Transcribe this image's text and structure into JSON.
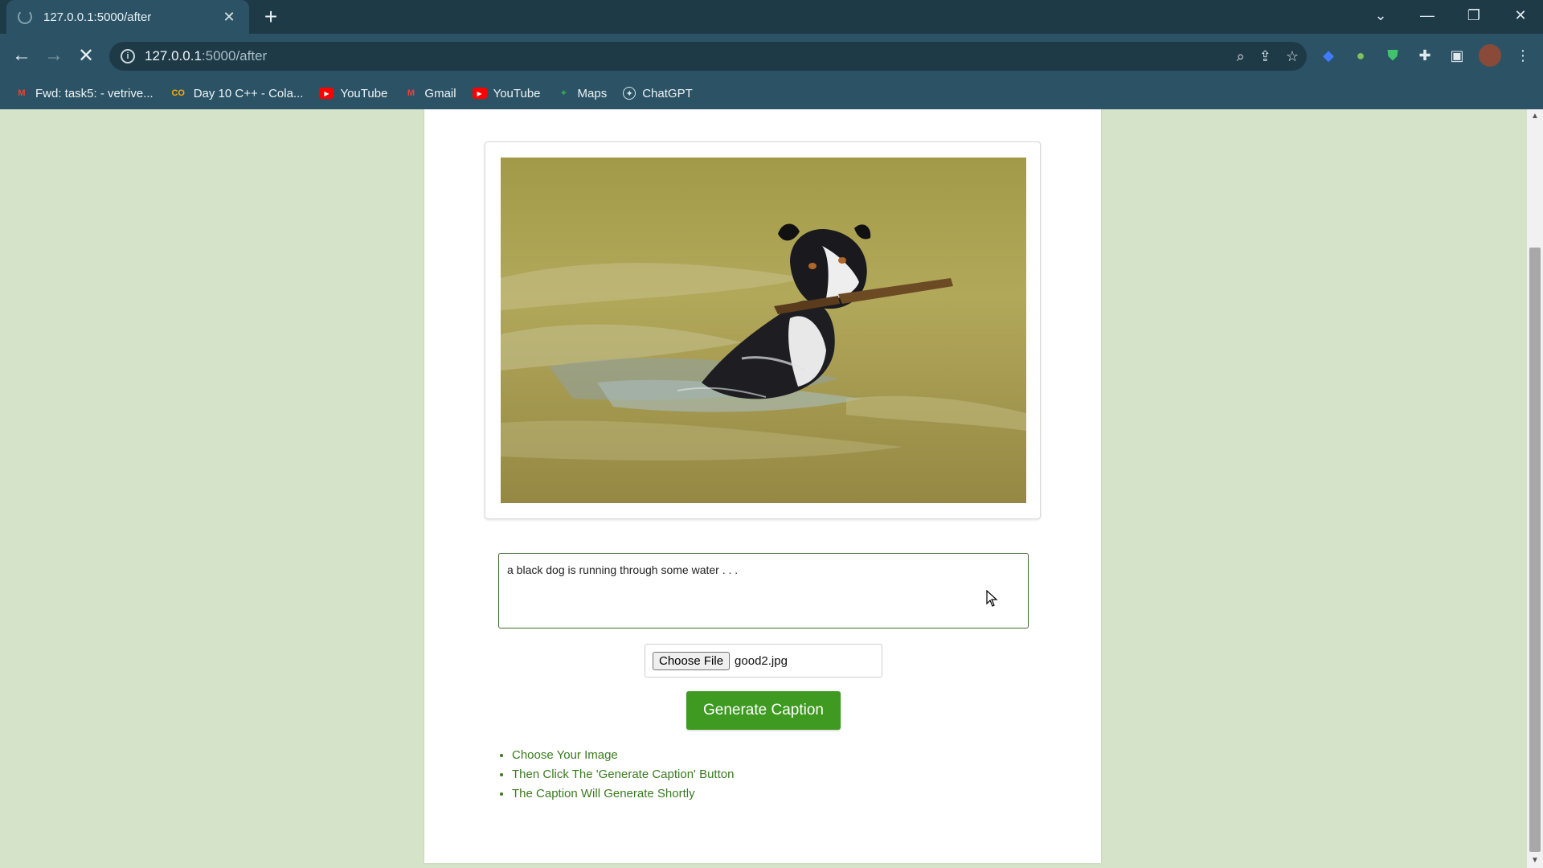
{
  "browser": {
    "tab_title": "127.0.0.1:5000/after",
    "url_host": "127.0.0.1",
    "url_path": ":5000/after",
    "bookmarks": [
      {
        "label": "Fwd: task5: - vetrive...",
        "icon": "gmail-icon"
      },
      {
        "label": "Day 10 C++ - Cola...",
        "icon": "colab-icon"
      },
      {
        "label": "YouTube",
        "icon": "youtube-icon"
      },
      {
        "label": "Gmail",
        "icon": "gmail-icon"
      },
      {
        "label": "YouTube",
        "icon": "youtube-icon"
      },
      {
        "label": "Maps",
        "icon": "maps-icon"
      },
      {
        "label": "ChatGPT",
        "icon": "chatgpt-icon"
      }
    ]
  },
  "page": {
    "caption_text": "a black dog is running through some water . . .",
    "file_button_label": "Choose File",
    "file_name": "good2.jpg",
    "generate_button_label": "Generate Caption",
    "steps": [
      "Choose Your Image",
      "Then Click The 'Generate Caption' Button",
      "The Caption Will Generate Shortly"
    ]
  },
  "colors": {
    "page_background": "#d5e3c8",
    "button_green": "#3e9a21",
    "step_text_green": "#3a7a1f",
    "chrome_dark": "#1f3a47",
    "chrome_mid": "#2c5365"
  }
}
